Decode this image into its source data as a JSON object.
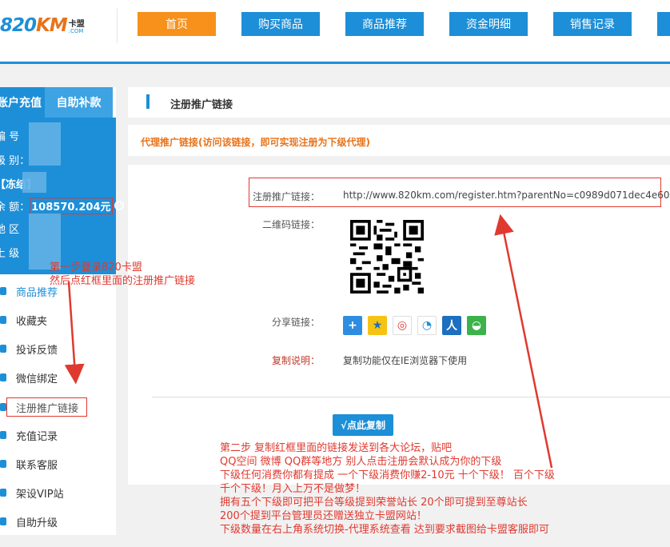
{
  "header": {
    "logo_main_prefix": "820",
    "logo_main_suffix": "KM",
    "logo_side_top": "卡盟",
    "logo_side_bottom": ".COM",
    "nav": [
      "首页",
      "购买商品",
      "商品推荐",
      "资金明细",
      "销售记录"
    ],
    "active_nav": "首页"
  },
  "sidebar": {
    "tabs": [
      "账户充值",
      "自助补款"
    ],
    "info": {
      "row1": "编 号",
      "row2": "级 别：",
      "row3": "【冻结】",
      "balance_label": "余 额：",
      "balance_value": "108570.204元",
      "row5": "地 区",
      "row6": "上 级"
    },
    "menu": [
      {
        "label": "商品推荐",
        "icon": "recommend-icon"
      },
      {
        "label": "收藏夹",
        "icon": "favorite-icon"
      },
      {
        "label": "投诉反馈",
        "icon": "feedback-icon"
      },
      {
        "label": "微信绑定",
        "icon": "wechat-icon"
      },
      {
        "label": "注册推广链接",
        "icon": "share-icon"
      },
      {
        "label": "充值记录",
        "icon": "recharge-icon"
      },
      {
        "label": "联系客服",
        "icon": "service-icon"
      },
      {
        "label": "架设VIP站",
        "icon": "vip-icon"
      },
      {
        "label": "自助升级",
        "icon": "upgrade-icon"
      }
    ]
  },
  "main": {
    "title": "注册推广链接",
    "notice": "代理推广链接(访问该链接，即可实现注册为下级代理)",
    "link_label": "注册推广链接：",
    "link_value": "http://www.820km.com/register.htm?parentNo=c0989d071dec4e60",
    "qr_label": "二维码链接：",
    "share_label": "分享链接：",
    "share_icons": [
      "plus-share-icon",
      "qzone-icon",
      "weibo-icon",
      "tencent-weibo-icon",
      "renren-icon",
      "wechat-share-icon"
    ],
    "copy_label": "复制说明：",
    "copy_note": "复制功能仅在IE浏览器下使用",
    "copy_button": "√点此复制"
  },
  "annotations": {
    "step1": [
      "第一步登录820卡盟",
      "然后点红框里面的注册推广链接"
    ],
    "step2": [
      "第二步 复制红框里面的链接发送到各大论坛，贴吧",
      "QQ空间 微博 QQ群等地方 别人点击注册会默认成为你的下级",
      "下级任何消费你都有提成 一个下级消费你赚2-10元 十个下级！ 百个下级",
      "千个下级！月入上万不是做梦！",
      "拥有五个下级即可把平台等级提到荣誉站长 20个即可提到至尊站长",
      "200个提到平台管理员还赠送独立卡盟网站！",
      "下级数量在右上角系统切换-代理系统查看 达到要求截图给卡盟客服即可"
    ]
  },
  "colors": {
    "accent": "#1d8fd8",
    "orange": "#f7911c",
    "annotation_red": "#e0392f"
  }
}
